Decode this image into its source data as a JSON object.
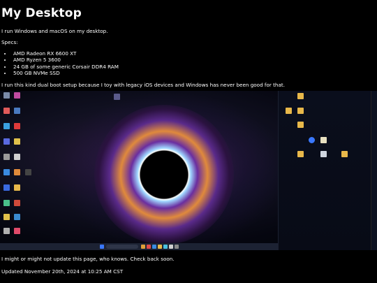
{
  "page": {
    "title": "My Desktop",
    "intro": "I run Windows and macOS on my desktop.",
    "specs_label": "Specs:",
    "specs": [
      "AMD Radeon RX 6600 XT",
      "AMD Ryzen 5 3600",
      "24 GB of some generic Corsair DDR4 RAM",
      "500 GB NVMe SSD"
    ],
    "reason": "I run this kind dual boot setup because I toy with legacy iOS devices and Windows has never been good for that.",
    "footer_note": "I might or might not update this page, who knows. Check back soon.",
    "updated": "Updated November 20th, 2024 at 10:25 AM CST"
  },
  "screenshot": {
    "alt_theme": "black hole wallpaper",
    "colors": {
      "folder": "#e8b84a",
      "taskbar": "#1c2233",
      "accent": "#3a78ff"
    }
  }
}
